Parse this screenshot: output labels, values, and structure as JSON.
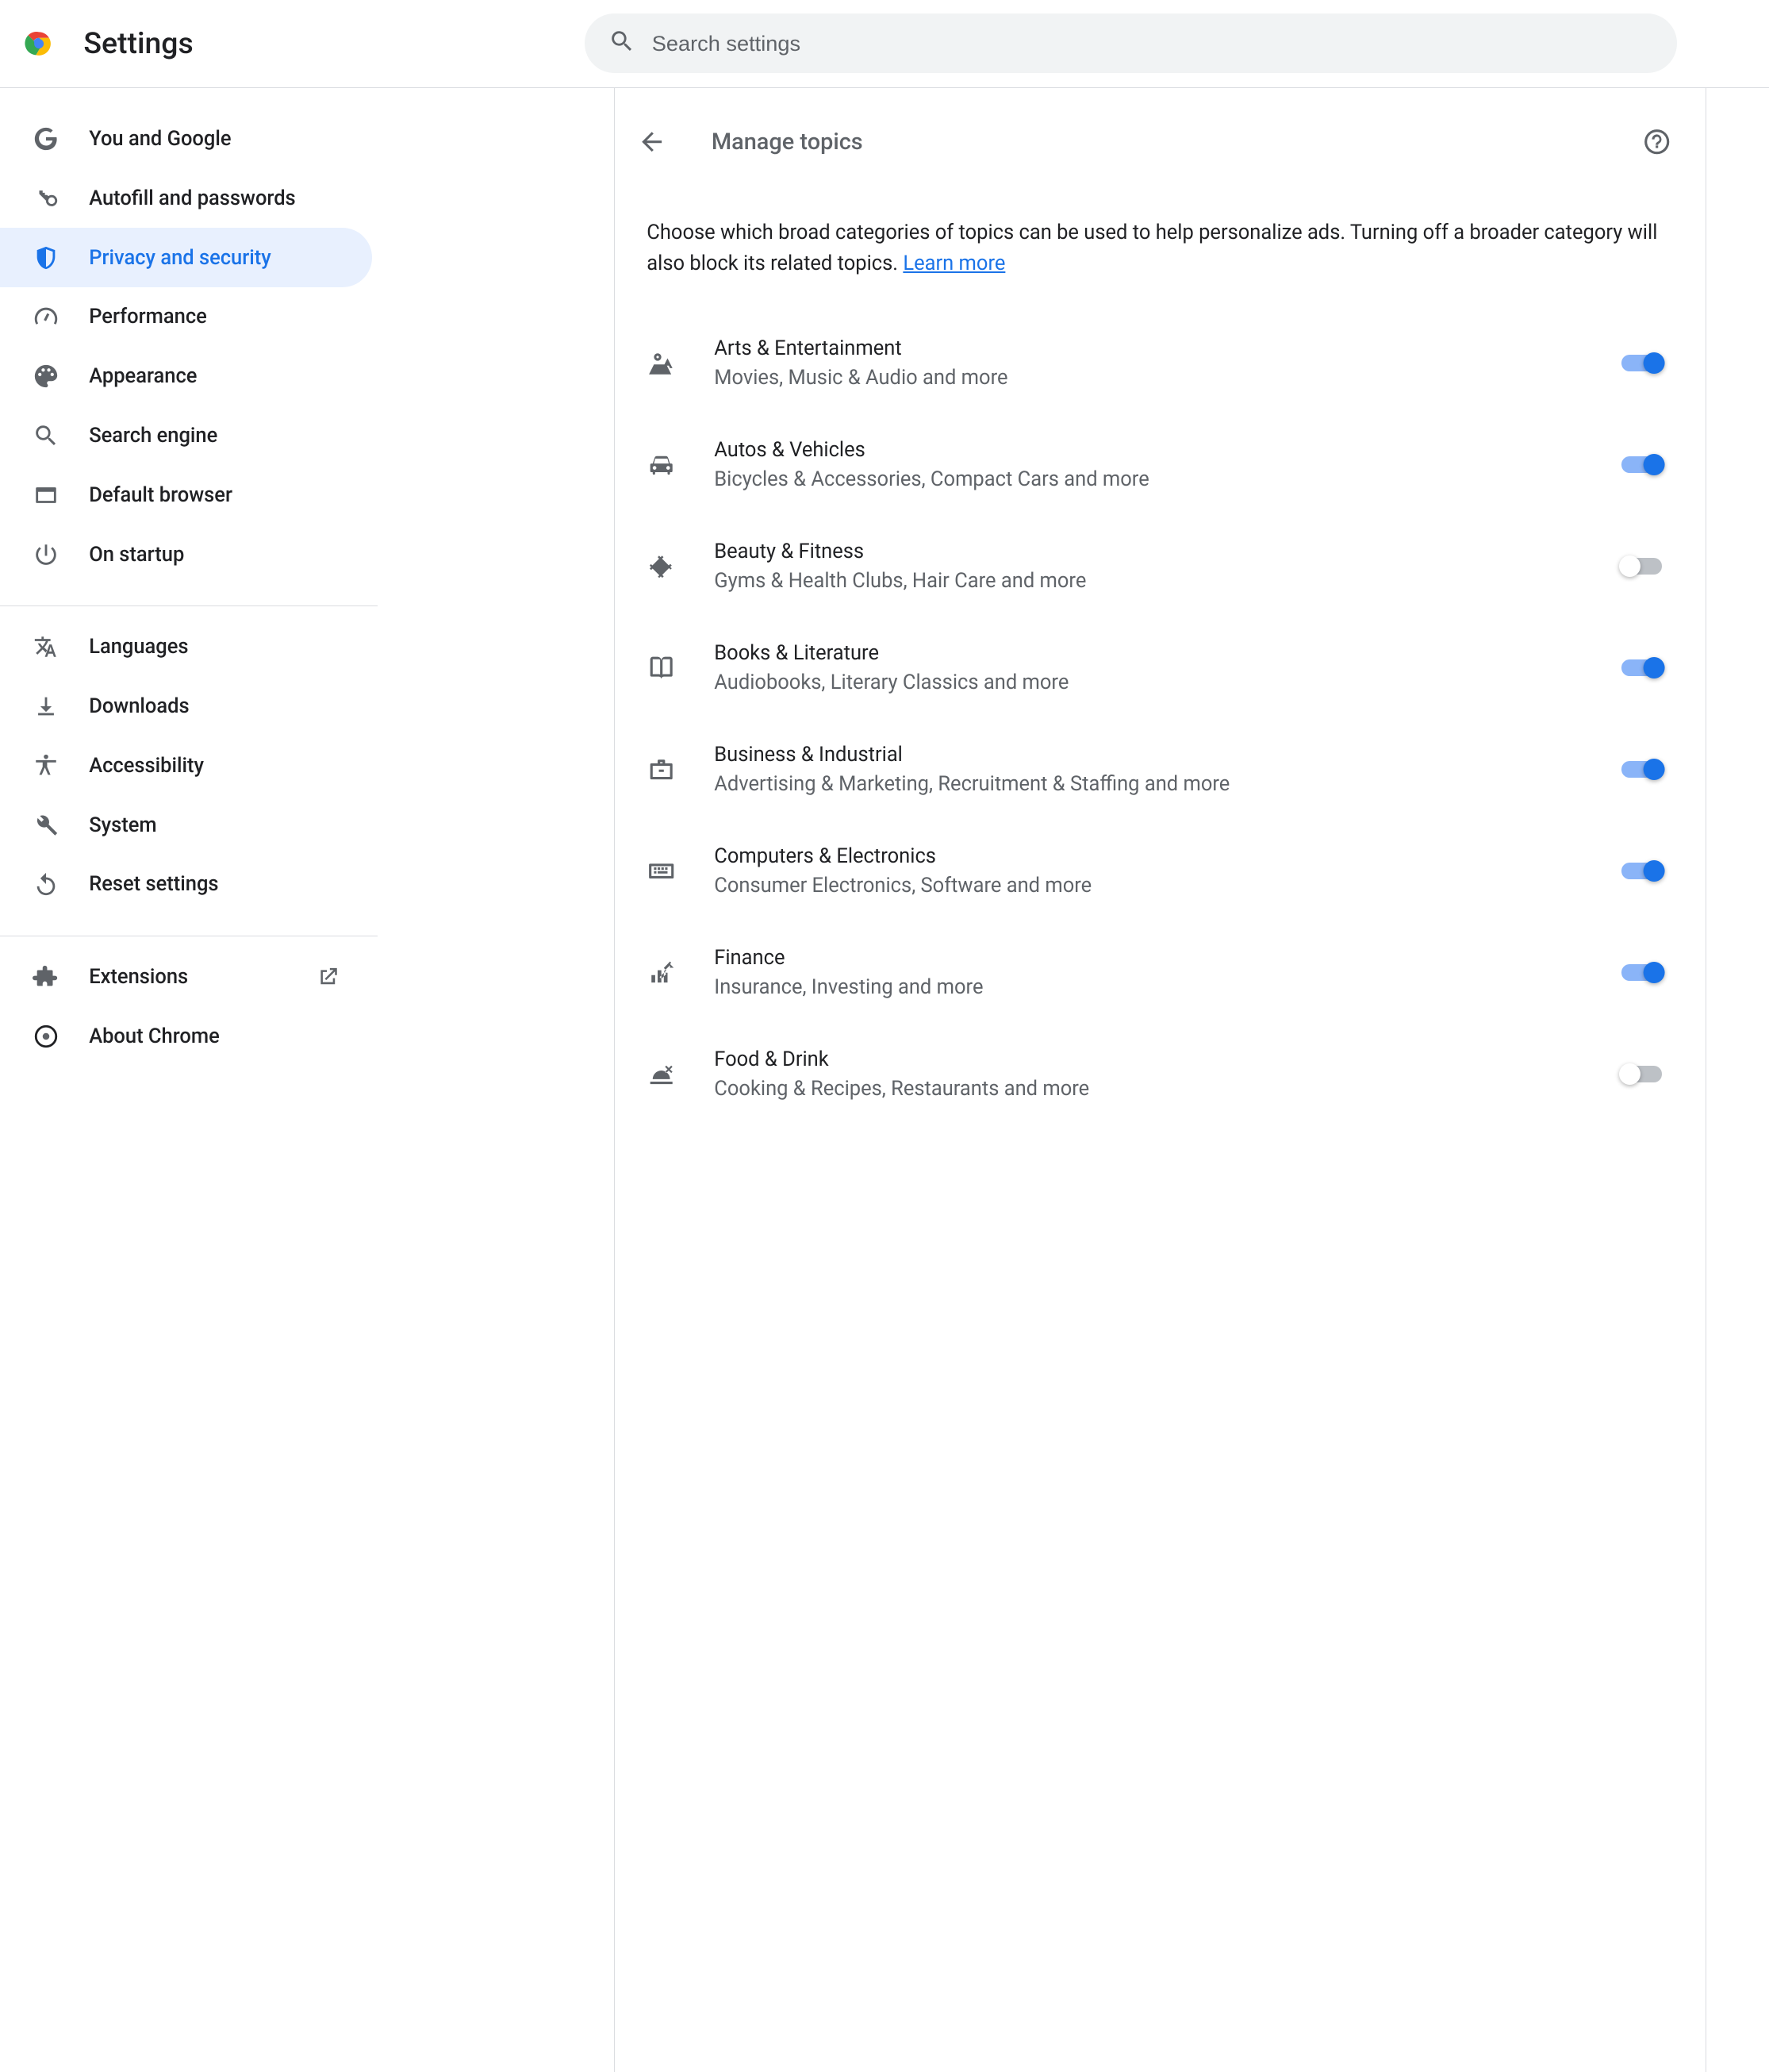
{
  "header": {
    "title": "Settings",
    "search_placeholder": "Search settings"
  },
  "sidebar": {
    "items": [
      {
        "id": "you-and-google",
        "label": "You and Google",
        "icon": "google",
        "active": false
      },
      {
        "id": "autofill",
        "label": "Autofill and passwords",
        "icon": "key",
        "active": false
      },
      {
        "id": "privacy",
        "label": "Privacy and security",
        "icon": "shield",
        "active": true
      },
      {
        "id": "performance",
        "label": "Performance",
        "icon": "speed",
        "active": false
      },
      {
        "id": "appearance",
        "label": "Appearance",
        "icon": "palette",
        "active": false
      },
      {
        "id": "search-engine",
        "label": "Search engine",
        "icon": "search",
        "active": false
      },
      {
        "id": "default-browser",
        "label": "Default browser",
        "icon": "window",
        "active": false
      },
      {
        "id": "on-startup",
        "label": "On startup",
        "icon": "power",
        "active": false
      }
    ],
    "advanced": [
      {
        "id": "languages",
        "label": "Languages",
        "icon": "translate"
      },
      {
        "id": "downloads",
        "label": "Downloads",
        "icon": "download"
      },
      {
        "id": "accessibility",
        "label": "Accessibility",
        "icon": "accessibility"
      },
      {
        "id": "system",
        "label": "System",
        "icon": "wrench"
      },
      {
        "id": "reset",
        "label": "Reset settings",
        "icon": "reset"
      }
    ],
    "footer": [
      {
        "id": "extensions",
        "label": "Extensions",
        "icon": "extension",
        "external": true
      },
      {
        "id": "about",
        "label": "About Chrome",
        "icon": "chrome"
      }
    ]
  },
  "page": {
    "title": "Manage topics",
    "description": "Choose which broad categories of topics can be used to help personalize ads. Turning off a broader category will also block its related topics. ",
    "learn_more": "Learn more"
  },
  "topics": [
    {
      "id": "arts",
      "title": "Arts & Entertainment",
      "sub": "Movies, Music & Audio and more",
      "icon": "arts",
      "on": true
    },
    {
      "id": "autos",
      "title": "Autos & Vehicles",
      "sub": "Bicycles & Accessories, Compact Cars and more",
      "icon": "car",
      "on": true
    },
    {
      "id": "beauty",
      "title": "Beauty & Fitness",
      "sub": "Gyms & Health Clubs, Hair Care and more",
      "icon": "fitness",
      "on": false
    },
    {
      "id": "books",
      "title": "Books & Literature",
      "sub": "Audiobooks, Literary Classics and more",
      "icon": "book",
      "on": true
    },
    {
      "id": "business",
      "title": "Business & Industrial",
      "sub": "Advertising & Marketing, Recruitment & Staffing and more",
      "icon": "briefcase",
      "on": true
    },
    {
      "id": "computers",
      "title": "Computers & Electronics",
      "sub": "Consumer Electronics, Software and more",
      "icon": "keyboard",
      "on": true
    },
    {
      "id": "finance",
      "title": "Finance",
      "sub": "Insurance, Investing and more",
      "icon": "finance",
      "on": true
    },
    {
      "id": "food",
      "title": "Food & Drink",
      "sub": "Cooking & Recipes, Restaurants and more",
      "icon": "food",
      "on": false
    }
  ]
}
